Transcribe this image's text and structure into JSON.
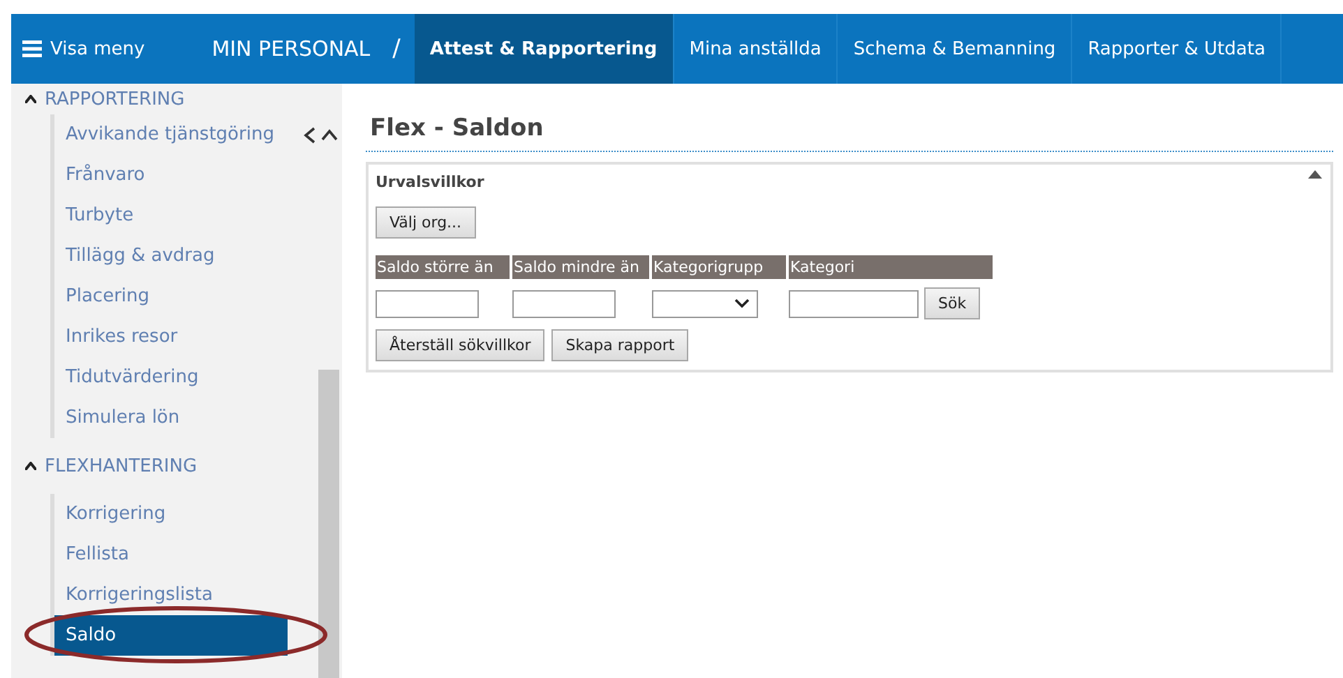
{
  "nav": {
    "menu_label": "Visa meny",
    "breadcrumb": "MIN PERSONAL",
    "separator": "/",
    "tabs": [
      {
        "label": "Attest & Rapportering",
        "selected": true
      },
      {
        "label": "Mina anställda",
        "selected": false
      },
      {
        "label": "Schema & Bemanning",
        "selected": false
      },
      {
        "label": "Rapporter & Utdata",
        "selected": false
      }
    ]
  },
  "sidebar": {
    "sections": [
      {
        "title": "RAPPORTERING",
        "expanded": true,
        "items": [
          {
            "label": "Avvikande tjänstgöring",
            "selected": false
          },
          {
            "label": "Frånvaro",
            "selected": false
          },
          {
            "label": "Turbyte",
            "selected": false
          },
          {
            "label": "Tillägg & avdrag",
            "selected": false
          },
          {
            "label": "Placering",
            "selected": false
          },
          {
            "label": "Inrikes resor",
            "selected": false
          },
          {
            "label": "Tidutvärdering",
            "selected": false
          },
          {
            "label": "Simulera lön",
            "selected": false
          }
        ]
      },
      {
        "title": "FLEXHANTERING",
        "expanded": true,
        "items": [
          {
            "label": "Korrigering",
            "selected": false
          },
          {
            "label": "Fellista",
            "selected": false
          },
          {
            "label": "Korrigeringslista",
            "selected": false
          },
          {
            "label": "Saldo",
            "selected": true,
            "highlighted": true
          }
        ]
      }
    ]
  },
  "page": {
    "title": "Flex - Saldon",
    "panel": {
      "title": "Urvalsvillkor",
      "org_button": "Välj org...",
      "columns": [
        "Saldo större än",
        "Saldo mindre än",
        "Kategorigrupp",
        "Kategori"
      ],
      "fields": [
        {
          "kind": "text"
        },
        {
          "kind": "text"
        },
        {
          "kind": "select"
        },
        {
          "kind": "text"
        }
      ],
      "search_button": "Sök",
      "buttons": [
        "Återställ sökvillkor",
        "Skapa rapport"
      ]
    }
  }
}
